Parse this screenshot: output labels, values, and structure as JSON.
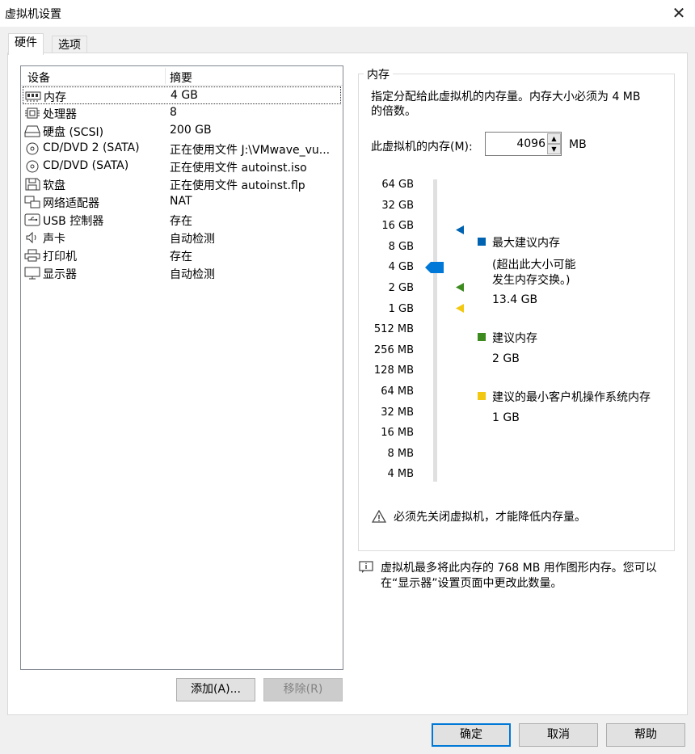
{
  "window": {
    "title": "虚拟机设置",
    "close_glyph": "✕"
  },
  "tabs": [
    {
      "label": "硬件"
    },
    {
      "label": "选项"
    }
  ],
  "device_list": {
    "col_device": "设备",
    "col_summary": "摘要",
    "rows": [
      {
        "name": "内存",
        "summary": "4 GB",
        "icon": "memory-icon"
      },
      {
        "name": "处理器",
        "summary": "8",
        "icon": "processor-icon"
      },
      {
        "name": "硬盘 (SCSI)",
        "summary": "200 GB",
        "icon": "hard-disk-icon"
      },
      {
        "name": "CD/DVD 2 (SATA)",
        "summary": "正在使用文件 J:\\VMwave_vu...",
        "icon": "cd-dvd-icon"
      },
      {
        "name": "CD/DVD (SATA)",
        "summary": "正在使用文件 autoinst.iso",
        "icon": "cd-dvd-icon"
      },
      {
        "name": "软盘",
        "summary": "正在使用文件 autoinst.flp",
        "icon": "floppy-icon"
      },
      {
        "name": "网络适配器",
        "summary": "NAT",
        "icon": "network-adapter-icon"
      },
      {
        "name": "USB 控制器",
        "summary": "存在",
        "icon": "usb-icon"
      },
      {
        "name": "声卡",
        "summary": "自动检测",
        "icon": "speaker-icon"
      },
      {
        "name": "打印机",
        "summary": "存在",
        "icon": "printer-icon"
      },
      {
        "name": "显示器",
        "summary": "自动检测",
        "icon": "monitor-icon"
      }
    ],
    "selected_index": 0,
    "add_button": "添加(A)...",
    "remove_button": "移除(R)"
  },
  "memory": {
    "group_label": "内存",
    "description_line1": "指定分配给此虚拟机的内存量。内存大小必须为 4 MB",
    "description_line2": "的倍数。",
    "field_label": "此虚拟机的内存(M):",
    "value": "4096",
    "unit": "MB",
    "scale": [
      "64 GB",
      "32 GB",
      "16 GB",
      "8 GB",
      "4 GB",
      "2 GB",
      "1 GB",
      "512 MB",
      "256 MB",
      "128 MB",
      "64 MB",
      "32 MB",
      "16 MB",
      "8 MB",
      "4 MB"
    ],
    "current_slider_label": "4 GB",
    "max_recommended": {
      "title": "最大建议内存",
      "note_line1": "(超出此大小可能",
      "note_line2": "发生内存交换。)",
      "value": "13.4 GB",
      "color": "#0063b1"
    },
    "recommended": {
      "title": "建议内存",
      "value": "2 GB",
      "color": "#3d8b1e"
    },
    "min_guest": {
      "title": "建议的最小客户机操作系统内存",
      "value": "1 GB",
      "color": "#f2c811"
    },
    "warning": "必须先关闭虚拟机，才能降低内存量。"
  },
  "info": {
    "line1": "虚拟机最多将此内存的 768 MB 用作图形内存。您可以",
    "line2": "在“显示器”设置页面中更改此数量。"
  },
  "footer": {
    "ok": "确定",
    "cancel": "取消",
    "help": "帮助"
  }
}
